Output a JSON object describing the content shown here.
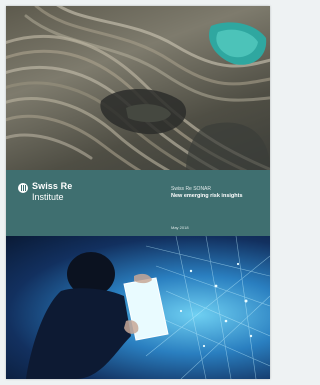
{
  "cover": {
    "brand_line1": "Swiss Re",
    "brand_line2": "Institute",
    "series": "Swiss Re SONAR",
    "title": "New emerging risk insights",
    "date": "May 2018"
  },
  "images": {
    "top": "aerial view of an open-pit mine with terraced rock walls and turquoise water",
    "bottom": "silhouette of a person holding a glowing tablet against a blue digital network"
  },
  "colors": {
    "band": "#3f6f70",
    "text": "#ffffff",
    "mine_water": "#2fa7a0",
    "digital_glow": "#6fd0f2"
  }
}
